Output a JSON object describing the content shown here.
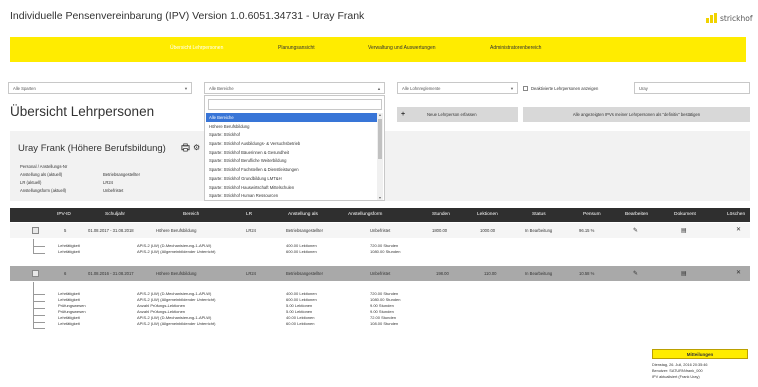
{
  "app": {
    "title": "Individuelle Pensenvereinbarung (IPV) Version 1.0.6051.34731 - Uray Frank",
    "logo_text": "strickhof"
  },
  "colors": {
    "brand": "#ffec00",
    "header_dark": "#2f2f2f",
    "selected": "#3875d7"
  },
  "nav": [
    {
      "label": "Übersicht Lehrpersonen",
      "active": true
    },
    {
      "label": "Planungsansicht",
      "active": false
    },
    {
      "label": "Verwaltung und Auswertungen",
      "active": false
    },
    {
      "label": "Administratorenbereich",
      "active": false
    }
  ],
  "filters": {
    "sparten": "Alle Sparten",
    "bereiche": "Alle Bereiche",
    "lohnreglemente": "Alle Lohnreglemente",
    "deaktivierte_label": "Deaktivierte Lehrpersonen anzeigen",
    "search_value": "Uray"
  },
  "page_title": "Übersicht Lehrpersonen",
  "bereiche_options": [
    "Alle Bereiche",
    "Höhere Berufsbildung",
    "Sparte: Strickhof",
    "Sparte: Strickhof Ausbildungs- & Versuchsbetrieb",
    "Sparte: Strickhof Bäuerinnen & Gesundheit",
    "Sparte: Strickhof Berufliche Weiterbildung",
    "Sparte: Strickhof Fachstellen & Dienstleistungen",
    "Sparte: Strickhof Grundbildung LMT&H",
    "Sparte: Strickhof Hauswirtschaft Mittelschulen",
    "Sparte: Strickhof Human Ressourcen"
  ],
  "buttons": {
    "new_teacher": "Neue Lehrperson erfassen",
    "confirm_all": "Alle angezeigten IPVs meiner Lehrpersonen als \"definitiv\" bestätigen"
  },
  "person": {
    "name": "Uray Frank (Höhere Berufsbildung)",
    "details": [
      {
        "label": "Personal / Anstellungs-Nr",
        "value": ""
      },
      {
        "label": "Anstellung als (aktuell)",
        "value": "Betriebsangestellter"
      },
      {
        "label": "LR (aktuell)",
        "value": "LR24"
      },
      {
        "label": "Anstellungsform (aktuell)",
        "value": "Unbefristet"
      }
    ]
  },
  "table": {
    "headers": [
      "IPV-ID",
      "Schuljahr",
      "Bereich",
      "LR",
      "Anstellung als",
      "Anstellungsform",
      "Stunden",
      "Lektionen",
      "Status",
      "Pensum",
      "Bearbeiten",
      "Dokument",
      "Löschen"
    ],
    "rows": [
      {
        "id": "5",
        "schuljahr": "01.08.2017 - 31.08.2018",
        "bereich": "Höhere Berufsbildung",
        "lr": "LR24",
        "anstellung": "Betriebsangestellter",
        "form": "Unbefristet",
        "stunden": "1800.00",
        "lektionen": "1000.00",
        "status": "In Bearbeitung",
        "pensum": "96.15 %",
        "subs": [
          {
            "typ": "Lehrtätigkeit",
            "fach": "APIS-2 (LW) (D-Mechanisierung-1-APLW)",
            "menge": "400.00 Lektionen",
            "stunden": "720.00 Stunden"
          },
          {
            "typ": "Lehrtätigkeit",
            "fach": "APIS-2 (LW) (Allgemeinbildender Unterricht)",
            "menge": "600.00 Lektionen",
            "stunden": "1080.00 Stunden"
          }
        ]
      },
      {
        "id": "6",
        "schuljahr": "01.08.2016 - 31.08.2017",
        "bereich": "Höhere Berufsbildung",
        "lr": "LR24",
        "anstellung": "Betriebsangestellter",
        "form": "Unbefristet",
        "stunden": "198.00",
        "lektionen": "110.00",
        "status": "In Bearbeitung",
        "pensum": "10.58 %",
        "subs": [
          {
            "typ": "Lehrtätigkeit",
            "fach": "APIS-2 (LW) (D-Mechanisierung-1-APLW)",
            "menge": "400.00 Lektionen",
            "stunden": "720.00 Stunden"
          },
          {
            "typ": "Lehrtätigkeit",
            "fach": "APIS-2 (LW) (Allgemeinbildender Unterricht)",
            "menge": "600.00 Lektionen",
            "stunden": "1080.00 Stunden"
          },
          {
            "typ": "Prüfungswesen",
            "fach": "Anzahl Prüfungs-Lektionen",
            "menge": "5.00 Lektionen",
            "stunden": "9.00 Stunden"
          },
          {
            "typ": "Prüfungswesen",
            "fach": "Anzahl Prüfungs-Lektionen",
            "menge": "5.00 Lektionen",
            "stunden": "9.00 Stunden"
          },
          {
            "typ": "Lehrtätigkeit",
            "fach": "APIS-2 (LW) (D-Mechanisierung-1-APLW)",
            "menge": "40.00 Lektionen",
            "stunden": "72.00 Stunden"
          },
          {
            "typ": "Lehrtätigkeit",
            "fach": "APIS-2 (LW) (Allgemeinbildender Unterricht)",
            "menge": "60.00 Lektionen",
            "stunden": "108.00 Stunden"
          }
        ]
      }
    ]
  },
  "messages": {
    "title": "Mitteilungen",
    "lines": [
      "Dienstag, 26. Juli, 2016 20:35:46",
      "Benutzer: SATURN\\frank_000",
      "IPV aktualisiert (Frank Uray)"
    ]
  }
}
